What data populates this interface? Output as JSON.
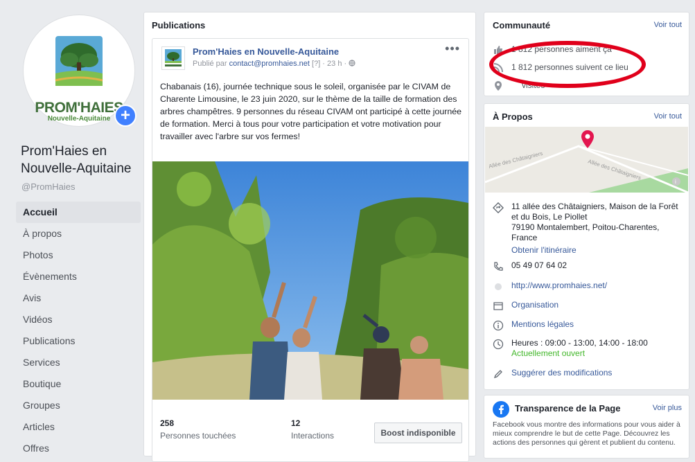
{
  "page": {
    "name": "Prom'Haies en Nouvelle-Aquitaine",
    "name_line1": "Prom'Haies en",
    "name_line2": "Nouvelle-Aquitaine",
    "handle": "@PromHaies",
    "avatar_brand": "PROM'HAIES",
    "avatar_sub": "Nouvelle-Aquitaine",
    "add_icon": "plus-icon"
  },
  "nav": {
    "items": [
      {
        "label": "Accueil"
      },
      {
        "label": "À propos"
      },
      {
        "label": "Photos"
      },
      {
        "label": "Évènements"
      },
      {
        "label": "Avis"
      },
      {
        "label": "Vidéos"
      },
      {
        "label": "Publications"
      },
      {
        "label": "Services"
      },
      {
        "label": "Boutique"
      },
      {
        "label": "Groupes"
      },
      {
        "label": "Articles"
      },
      {
        "label": "Offres"
      }
    ]
  },
  "publications": {
    "title": "Publications",
    "post": {
      "author": "Prom'Haies en Nouvelle-Aquitaine",
      "published_by": "Publié par",
      "published_email": "contact@promhaies.net",
      "published_suffix": "[?] · 23 h ·",
      "text": "Chabanais (16), journée technique sous le soleil, organisée par le CIVAM de Charente Limousine, le 23 juin 2020, sur le thème de la taille de formation des arbres champêtres. 9 personnes du réseau CIVAM ont participé à cette journée de formation. Merci à tous pour votre participation et votre motivation pour travailler avec l'arbre sur vos fermes!",
      "reach_value": "258",
      "reach_label": "Personnes touchées",
      "interactions_value": "12",
      "interactions_label": "Interactions",
      "boost_label": "Boost indisponible"
    }
  },
  "community": {
    "title": "Communauté",
    "see_all": "Voir tout",
    "likes_text": "1 812 personnes aiment ça",
    "follows_text": "1 812 personnes suivent ce lieu",
    "visits_text": "visites"
  },
  "about": {
    "title": "À Propos",
    "see_all": "Voir tout",
    "map_street_1": "Allée des Châtaigniers",
    "map_street_2": "Allée des Châtaigniers",
    "address_l1": "11 allée des Châtaigniers, Maison de la Forêt",
    "address_l2": "et du Bois, Le Piollet",
    "address_l3": "79190 Montalembert, Poitou-Charentes,",
    "address_l4": "France",
    "directions": "Obtenir l'itinéraire",
    "phone": "05 49 07 64 02",
    "website": "http://www.promhaies.net/",
    "category": "Organisation",
    "legal": "Mentions légales",
    "hours": "Heures : 09:00 - 13:00, 14:00 - 18:00",
    "open_status": "Actuellement ouvert",
    "suggest": "Suggérer des modifications"
  },
  "transparency": {
    "title": "Transparence de la Page",
    "see_more": "Voir plus",
    "text": "Facebook vous montre des informations pour vous aider à mieux comprendre le but de cette Page. Découvrez les actions des personnes qui gèrent et publient du contenu."
  },
  "colors": {
    "accent": "#365899",
    "annotation": "#e0001b",
    "open": "#42b72a"
  }
}
